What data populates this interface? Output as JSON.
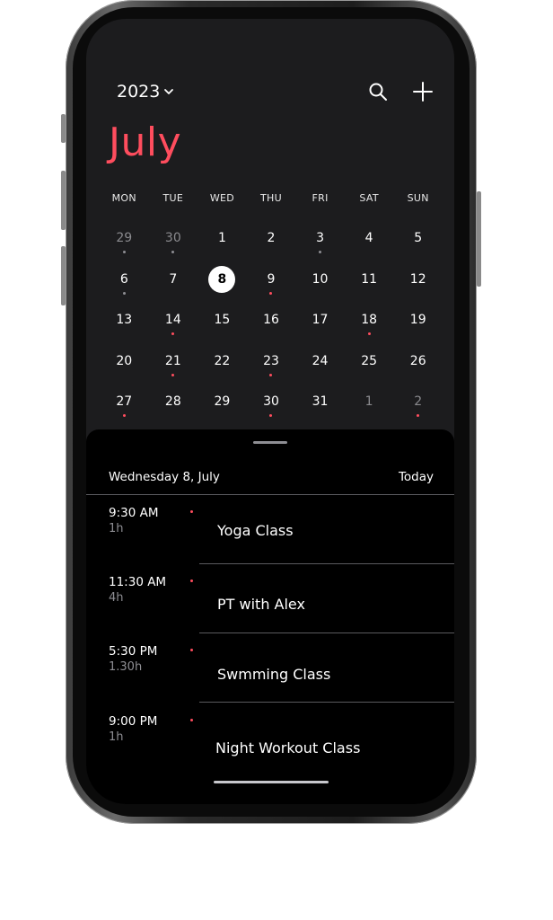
{
  "header": {
    "year": "2023",
    "month": "July"
  },
  "weekdays": [
    "MON",
    "TUE",
    "WED",
    "THU",
    "FRI",
    "SAT",
    "SUN"
  ],
  "calendar": {
    "days": [
      {
        "n": "29",
        "muted": true,
        "dot": "gray"
      },
      {
        "n": "30",
        "muted": true,
        "dot": "gray"
      },
      {
        "n": "1"
      },
      {
        "n": "2"
      },
      {
        "n": "3",
        "dot": "gray"
      },
      {
        "n": "4"
      },
      {
        "n": "5"
      },
      {
        "n": "6",
        "dot": "gray"
      },
      {
        "n": "7"
      },
      {
        "n": "8",
        "selected": true
      },
      {
        "n": "9",
        "dot": "red"
      },
      {
        "n": "10"
      },
      {
        "n": "11"
      },
      {
        "n": "12"
      },
      {
        "n": "13"
      },
      {
        "n": "14",
        "dot": "red"
      },
      {
        "n": "15"
      },
      {
        "n": "16"
      },
      {
        "n": "17"
      },
      {
        "n": "18",
        "dot": "red"
      },
      {
        "n": "19"
      },
      {
        "n": "20"
      },
      {
        "n": "21",
        "dot": "red"
      },
      {
        "n": "22"
      },
      {
        "n": "23",
        "dot": "red"
      },
      {
        "n": "24"
      },
      {
        "n": "25"
      },
      {
        "n": "26"
      },
      {
        "n": "27",
        "dot": "red"
      },
      {
        "n": "28"
      },
      {
        "n": "29"
      },
      {
        "n": "30",
        "dot": "red"
      },
      {
        "n": "31"
      },
      {
        "n": "1",
        "muted": true
      },
      {
        "n": "2",
        "muted": true,
        "dot": "red"
      }
    ]
  },
  "agenda": {
    "date_label": "Wednesday 8, July",
    "today_label": "Today",
    "events": [
      {
        "time": "9:30 AM",
        "duration": "1h",
        "title": "Yoga Class"
      },
      {
        "time": "11:30 AM",
        "duration": "4h",
        "title": "PT with Alex"
      },
      {
        "time": "5:30 PM",
        "duration": "1.30h",
        "title": "Swmming Class"
      },
      {
        "time": "9:00 PM",
        "duration": "1h",
        "title": "Night Workout Class"
      }
    ]
  },
  "colors": {
    "accent": "#ff4d5e",
    "dot_gray": "#8e8e93",
    "background": "#1c1c1e",
    "sheet": "#000000"
  },
  "icons": {
    "year_dropdown": "chevron-down-icon",
    "search": "search-icon",
    "add": "plus-icon"
  }
}
